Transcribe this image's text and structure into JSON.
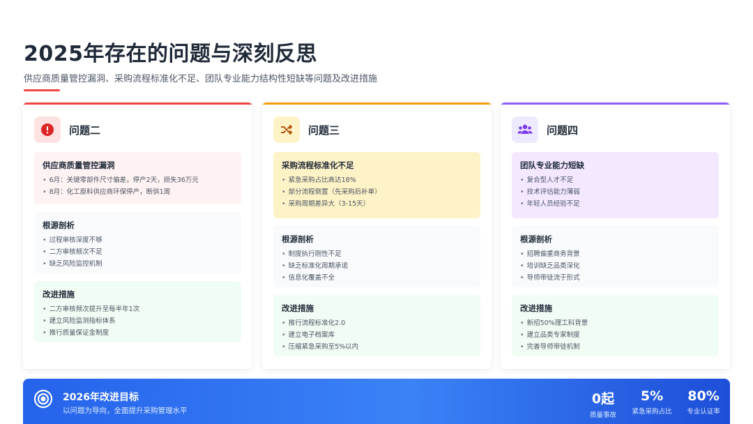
{
  "header": {
    "title": "2025年存在的问题与深刻反思",
    "subtitle": "供应商质量管控漏洞、采购流程标准化不足、团队专业能力结构性短缺等问题及改进措施"
  },
  "colors": {
    "red": "#ef4444",
    "amber": "#f59e0b",
    "purple": "#8b5cf6",
    "blue": "#2563eb"
  },
  "cards": [
    {
      "title": "问题二",
      "icon": "exclamation-circle-icon",
      "problem": {
        "title": "供应商质量管控漏洞",
        "items": [
          "6月：关键零部件尺寸偏差，停产2天，损失36万元",
          "8月：化工原料供应商环保停产，断供1周"
        ]
      },
      "root": {
        "title": "根源剖析",
        "items": [
          "过程审核深度不够",
          "二方审核频次不足",
          "缺乏风险监控机制"
        ]
      },
      "fix": {
        "title": "改进措施",
        "items": [
          "二方审核频次提升至每半年1次",
          "建立风险监测指标体系",
          "推行质量保证金制度"
        ]
      }
    },
    {
      "title": "问题三",
      "icon": "shuffle-icon",
      "problem": {
        "title": "采购流程标准化不足",
        "items": [
          "紧急采购占比高达18%",
          "部分流程倒置（先采购后补单）",
          "采购周期差异大（3-15天）"
        ]
      },
      "root": {
        "title": "根源剖析",
        "items": [
          "制度执行刚性不足",
          "缺乏标准化周期承诺",
          "信息化覆盖不全"
        ]
      },
      "fix": {
        "title": "改进措施",
        "items": [
          "推行流程标准化2.0",
          "建立电子档案库",
          "压缩紧急采购至5%以内"
        ]
      }
    },
    {
      "title": "问题四",
      "icon": "users-icon",
      "problem": {
        "title": "团队专业能力短缺",
        "items": [
          "复合型人才不足",
          "技术评估能力薄弱",
          "年轻人员经验不足"
        ]
      },
      "root": {
        "title": "根源剖析",
        "items": [
          "招聘偏重商务背景",
          "培训缺乏品类深化",
          "导师带徒流于形式"
        ]
      },
      "fix": {
        "title": "改进措施",
        "items": [
          "新招50%理工科背景",
          "建立品类专家制度",
          "完善导师带徒机制"
        ]
      }
    }
  ],
  "banner": {
    "icon": "target-icon",
    "title": "2026年改进目标",
    "subtitle": "以问题为导向，全面提升采购管理水平",
    "stats": [
      {
        "value": "0起",
        "label": "质量事故"
      },
      {
        "value": "5%",
        "label": "紧急采购占比"
      },
      {
        "value": "80%",
        "label": "专业认证率"
      }
    ]
  }
}
